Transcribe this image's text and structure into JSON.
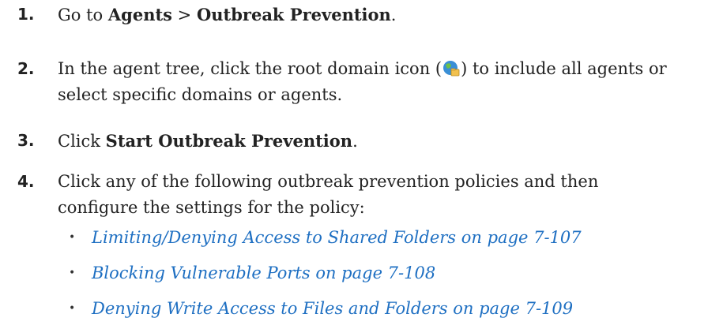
{
  "steps": [
    {
      "number": "1.",
      "prefix": "Go to ",
      "bold1": "Agents",
      "middle": " > ",
      "bold2": "Outbreak Prevention",
      "suffix": "."
    },
    {
      "number": "2.",
      "before_icon": "In the agent tree, click the root domain icon (",
      "icon": "root-domain-icon",
      "after_icon_line1": ") to include all agents or",
      "line2": "select specific domains or agents."
    },
    {
      "number": "3.",
      "prefix": "Click ",
      "bold": "Start Outbreak Prevention",
      "suffix": "."
    },
    {
      "number": "4.",
      "line1": "Click any of the following outbreak prevention policies and then",
      "line2": "configure the settings for the policy:"
    }
  ],
  "policy_links": [
    "Limiting/Denying Access to Shared Folders on page 7-107",
    "Blocking Vulnerable Ports on page 7-108",
    "Denying Write Access to Files and Folders on page 7-109"
  ],
  "bullet_glyph": "•",
  "colors": {
    "text": "#222222",
    "link": "#1e6fc2"
  }
}
